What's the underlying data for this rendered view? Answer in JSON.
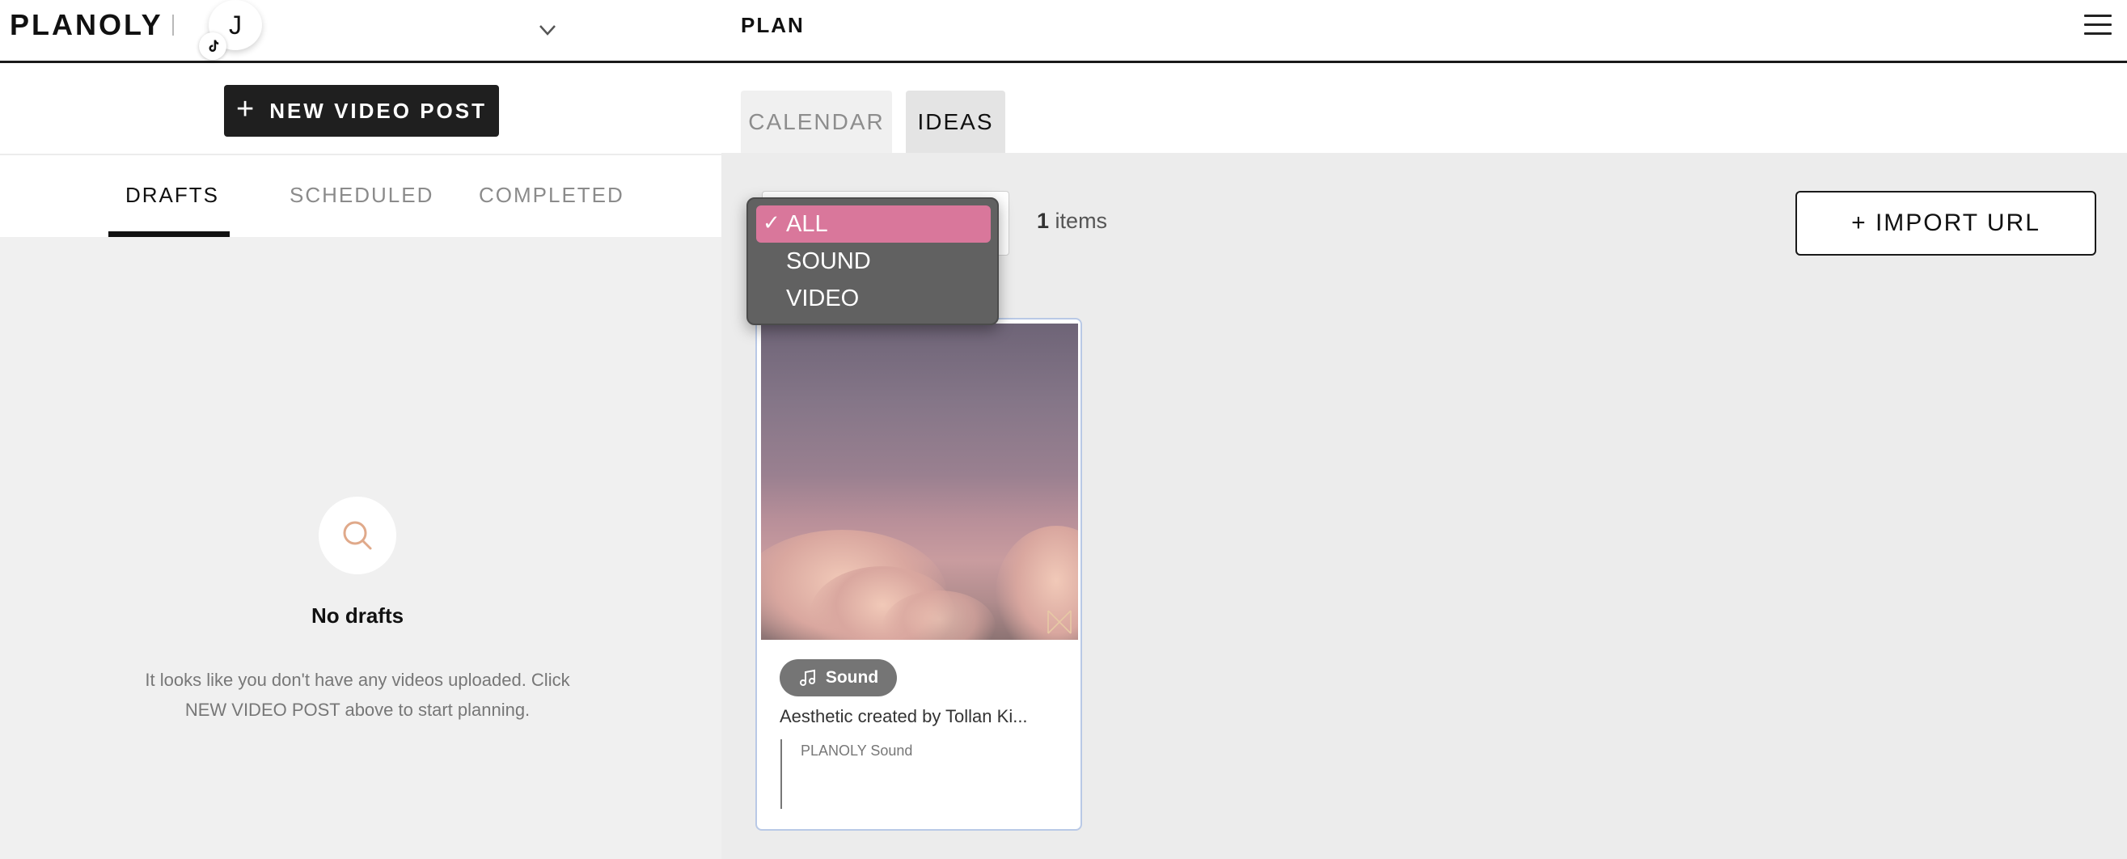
{
  "header": {
    "brand": "PLANOLY",
    "avatar_initial": "J",
    "page_title": "PLAN"
  },
  "left_panel": {
    "new_post_label": "NEW VIDEO POST",
    "tabs": [
      {
        "label": "DRAFTS",
        "active": true
      },
      {
        "label": "SCHEDULED",
        "active": false
      },
      {
        "label": "COMPLETED",
        "active": false
      }
    ],
    "empty_state": {
      "title": "No drafts",
      "description": "It looks like you don't have any videos uploaded. Click NEW VIDEO POST above to start planning."
    }
  },
  "right_panel": {
    "tabs": [
      {
        "label": "CALENDAR",
        "active": false
      },
      {
        "label": "IDEAS",
        "active": true
      }
    ],
    "items_count": "1",
    "items_label": "items",
    "import_label": "+ IMPORT URL",
    "filter_dropdown": {
      "options": [
        {
          "label": "ALL",
          "selected": true
        },
        {
          "label": "SOUND",
          "selected": false
        },
        {
          "label": "VIDEO",
          "selected": false
        }
      ],
      "check_glyph": "✓"
    },
    "idea_card": {
      "tag": "Sound",
      "title": "Aesthetic created by Tollan Ki...",
      "subtitle": "PLANOLY Sound"
    }
  },
  "colors": {
    "accent_pink": "#d9779b",
    "dark_button": "#1f1f1f",
    "panel_bg": "#ececec",
    "empty_icon": "#e0a98a"
  },
  "icons": [
    "tiktok-icon",
    "chevron-down-icon",
    "hamburger-menu-icon",
    "plus-icon",
    "search-icon",
    "music-note-icon",
    "checkmark-icon"
  ]
}
